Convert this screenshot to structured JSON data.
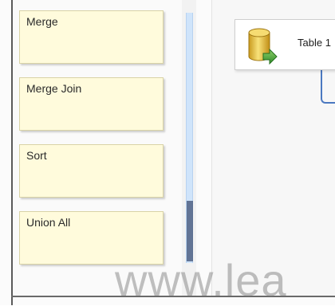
{
  "toolbox": {
    "items": [
      {
        "label": "Merge"
      },
      {
        "label": "Merge Join"
      },
      {
        "label": "Sort"
      },
      {
        "label": "Union All"
      }
    ]
  },
  "canvas": {
    "component_label": "Table 1",
    "component_icon": "database-source-icon"
  },
  "watermark": "www.lea"
}
